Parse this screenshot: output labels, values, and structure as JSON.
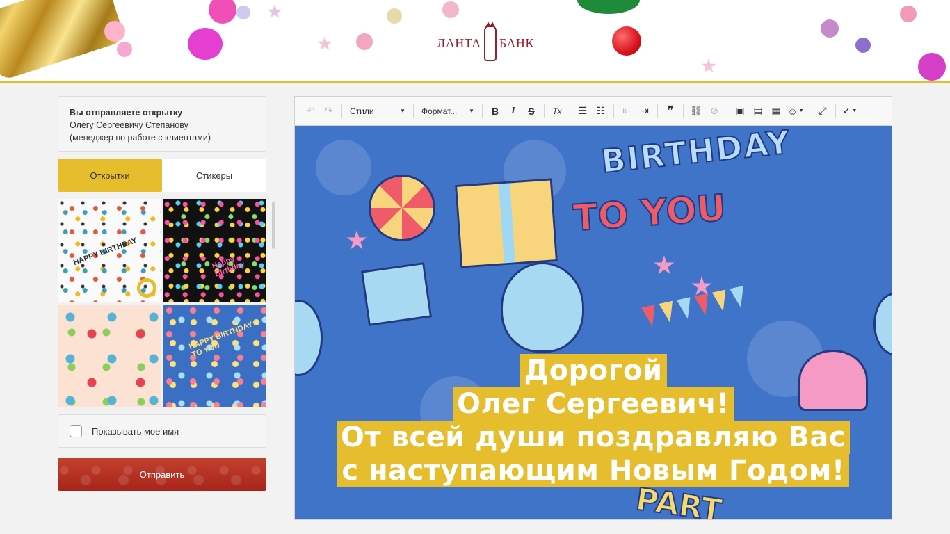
{
  "header": {
    "logo_left": "ЛАНТА",
    "logo_right": "БАНК"
  },
  "sender": {
    "title": "Вы отправляете открытку",
    "recipient": "Олегу Сергеевичу Степанову",
    "position": "(менеджер по работе с клиентами)"
  },
  "tabs": [
    {
      "label": "Открытки",
      "active": true
    },
    {
      "label": "Стикеры",
      "active": false
    }
  ],
  "cards": [
    {
      "text": "HAPPY BIRTHDAY",
      "selected": true
    },
    {
      "text": "Happy Birthday",
      "selected": false
    },
    {
      "text": "",
      "selected": false
    },
    {
      "text": "HAPPY BIRTHDAY TO YOU",
      "selected": false
    }
  ],
  "options": {
    "show_name_label": "Показывать мое имя",
    "show_name_checked": false
  },
  "actions": {
    "send_label": "Отправить"
  },
  "toolbar": {
    "styles_label": "Стили",
    "format_label": "Формат...",
    "undo_icon": "↶",
    "redo_icon": "↷",
    "bold_icon": "B",
    "italic_icon": "I",
    "strike_icon": "S",
    "clear_format_icon": "Tx",
    "ordered_list_icon": "☰",
    "bullet_list_icon": "☷",
    "outdent_icon": "⇤",
    "indent_icon": "⇥",
    "quote_icon": "❞",
    "link_icon": "⛓",
    "unlink_icon": "⊘",
    "image_icon": "▣",
    "template_icon": "▤",
    "table_icon": "▦",
    "emoji_icon": "☺",
    "maximize_icon": "⤢",
    "spellcheck_icon": "✓"
  },
  "card_preview": {
    "birthday_text": "BIRTHDAY",
    "toyou_text": "TO YOU",
    "party_text": "PART",
    "greeting_lines": [
      "Дорогой",
      "Олег Сергеевич!",
      "От всей души поздравляю Вас",
      "с наступающим Новым Годом!"
    ]
  },
  "colors": {
    "accent": "#e6bd2d",
    "send_button": "#b5311f",
    "brand": "#9b1c2a",
    "card_background": "#3f74c8"
  }
}
